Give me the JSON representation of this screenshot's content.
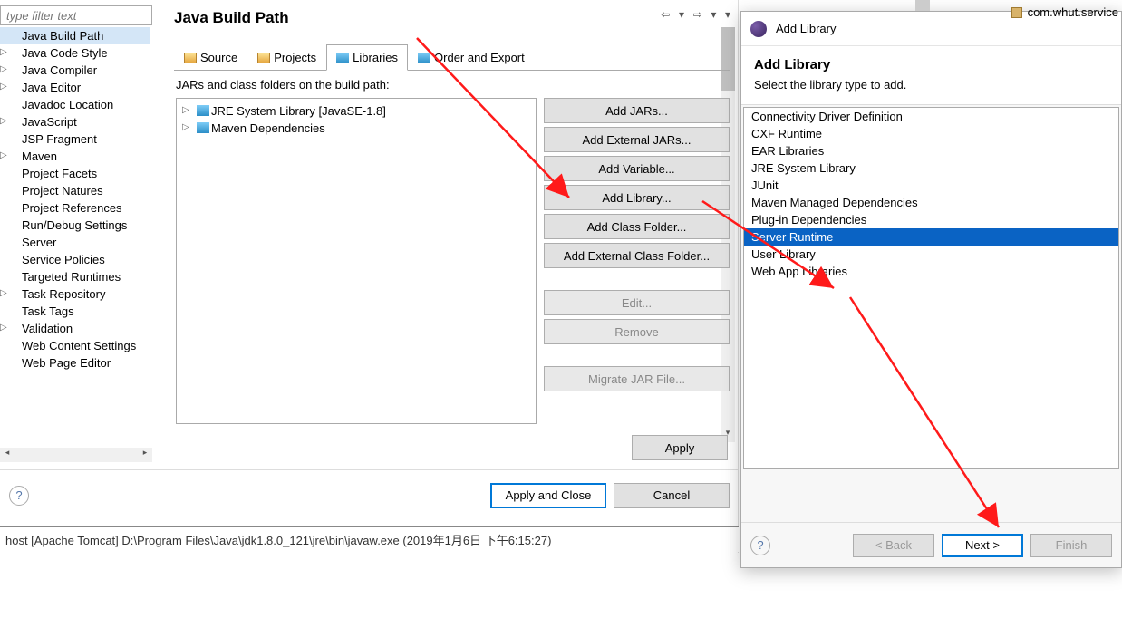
{
  "filter_placeholder": "type filter text",
  "page_title": "Java Build Path",
  "tree": [
    {
      "label": "Java Build Path",
      "level": 2,
      "selected": true
    },
    {
      "label": "Java Code Style",
      "level": 2,
      "expandable": true
    },
    {
      "label": "Java Compiler",
      "level": 2,
      "expandable": true
    },
    {
      "label": "Java Editor",
      "level": 2,
      "expandable": true
    },
    {
      "label": "Javadoc Location",
      "level": 2
    },
    {
      "label": "JavaScript",
      "level": 2,
      "expandable": true
    },
    {
      "label": "JSP Fragment",
      "level": 2
    },
    {
      "label": "Maven",
      "level": 2,
      "expandable": true
    },
    {
      "label": "Project Facets",
      "level": 2
    },
    {
      "label": "Project Natures",
      "level": 2
    },
    {
      "label": "Project References",
      "level": 2
    },
    {
      "label": "Run/Debug Settings",
      "level": 2
    },
    {
      "label": "Server",
      "level": 2
    },
    {
      "label": "Service Policies",
      "level": 2
    },
    {
      "label": "Targeted Runtimes",
      "level": 2
    },
    {
      "label": "Task Repository",
      "level": 2,
      "expandable": true
    },
    {
      "label": "Task Tags",
      "level": 2
    },
    {
      "label": "Validation",
      "level": 2,
      "expandable": true
    },
    {
      "label": "Web Content Settings",
      "level": 2
    },
    {
      "label": "Web Page Editor",
      "level": 2
    }
  ],
  "tabs": [
    {
      "label": "Source",
      "icon": "folder"
    },
    {
      "label": "Projects",
      "icon": "folder"
    },
    {
      "label": "Libraries",
      "icon": "lib",
      "active": true
    },
    {
      "label": "Order and Export",
      "icon": "lib"
    }
  ],
  "subtitle": "JARs and class folders on the build path:",
  "jars": [
    {
      "label": "JRE System Library [JavaSE-1.8]",
      "expandable": true
    },
    {
      "label": "Maven Dependencies",
      "expandable": true
    }
  ],
  "buttons": {
    "add_jars": "Add JARs...",
    "add_ext_jars": "Add External JARs...",
    "add_variable": "Add Variable...",
    "add_library": "Add Library...",
    "add_class_folder": "Add Class Folder...",
    "add_ext_class_folder": "Add External Class Folder...",
    "edit": "Edit...",
    "remove": "Remove",
    "migrate": "Migrate JAR File...",
    "apply": "Apply",
    "apply_close": "Apply and Close",
    "cancel": "Cancel"
  },
  "status_bar": "host [Apache Tomcat] D:\\Program Files\\Java\\jdk1.8.0_121\\jre\\bin\\javaw.exe (2019年1月6日 下午6:15:27)",
  "addlib": {
    "window_title": "Add Library",
    "heading": "Add Library",
    "subheading": "Select the library type to add.",
    "items": [
      "Connectivity Driver Definition",
      "CXF Runtime",
      "EAR Libraries",
      "JRE System Library",
      "JUnit",
      "Maven Managed Dependencies",
      "Plug-in Dependencies",
      "Server Runtime",
      "User Library",
      "Web App Libraries"
    ],
    "selected_index": 7,
    "back": "< Back",
    "next": "Next >",
    "finish": "Finish"
  },
  "remnant_package": "com.whut.service"
}
